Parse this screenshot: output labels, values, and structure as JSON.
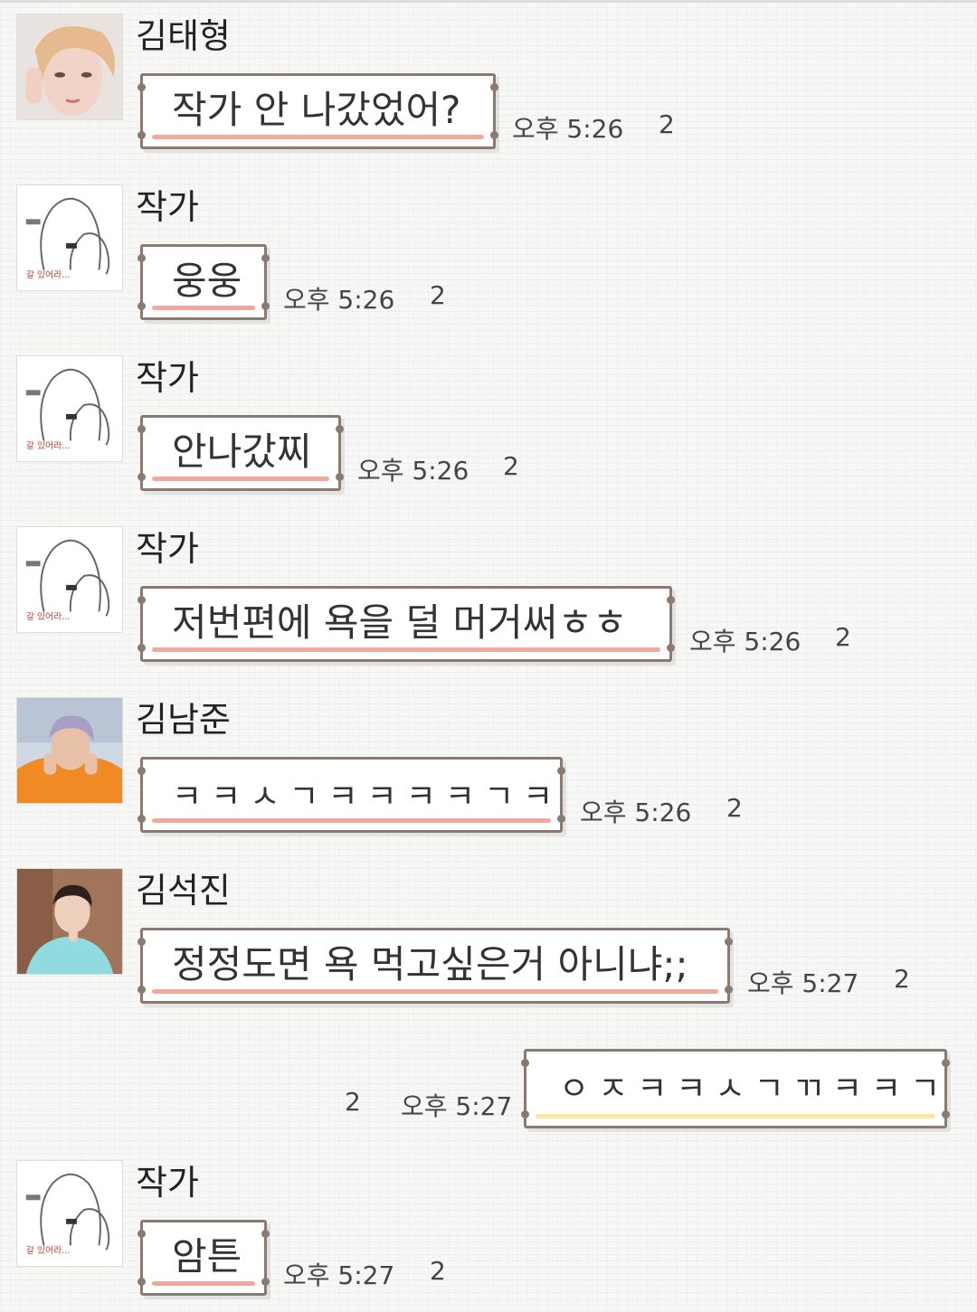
{
  "messages": [
    {
      "sender": "김태형",
      "avatar": "photo-avatar",
      "text": "작가 안 나갔었어?",
      "time": "오후 5:26",
      "unread": "2"
    },
    {
      "sender": "작가",
      "avatar": "ghost-avatar",
      "text": "웅웅",
      "time": "오후 5:26",
      "unread": "2"
    },
    {
      "sender": "작가",
      "avatar": "ghost-avatar",
      "text": "안나갔찌",
      "time": "오후 5:26",
      "unread": "2"
    },
    {
      "sender": "작가",
      "avatar": "ghost-avatar",
      "text": "저번편에 욕을 덜 머거써ㅎㅎ",
      "time": "오후 5:26",
      "unread": "2"
    },
    {
      "sender": "김남준",
      "avatar": "photo-avatar",
      "text": "ㅋㅋㅅㄱㅋㅋㅋㅋㄱㅋ",
      "time": "오후 5:26",
      "unread": "2"
    },
    {
      "sender": "김석진",
      "avatar": "photo-avatar",
      "text": "정정도면 욕 먹고싶은거 아니냐;;",
      "time": "오후 5:27",
      "unread": "2"
    },
    {
      "sender": "",
      "avatar": "",
      "text": "ㅇㅈㅋㅋㅅㄱㄲㅋㅋㄱ",
      "time": "오후 5:27",
      "unread": "2",
      "mine": true
    },
    {
      "sender": "작가",
      "avatar": "ghost-avatar",
      "text": "암튼",
      "time": "오후 5:27",
      "unread": "2"
    }
  ],
  "ghost_avatar_caption": "갈 있어라...",
  "colors": {
    "bubble_border": "#8a7a70",
    "incoming_underline": "#f2a89d",
    "outgoing_underline": "#fbe7a2"
  }
}
